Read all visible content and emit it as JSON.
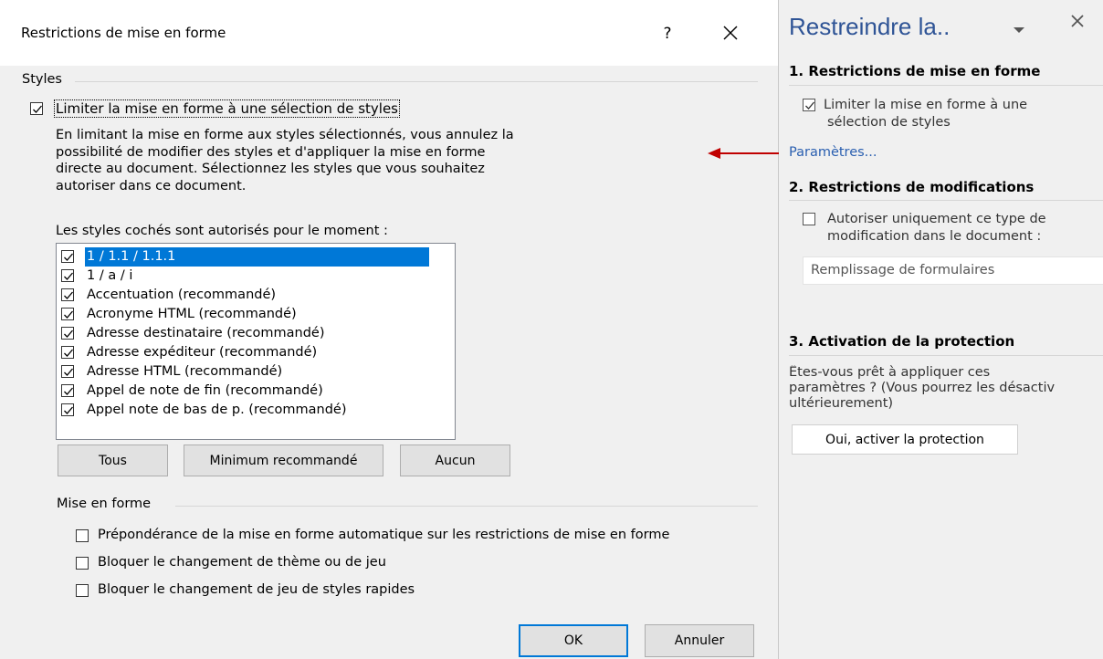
{
  "dialog": {
    "title": "Restrictions de mise en forme",
    "help_label": "?",
    "styles_group": "Styles",
    "limit_checkbox_label": "Limiter la mise en forme à une sélection de styles",
    "limit_checked": true,
    "description_lines": [
      "En limitant la mise en forme aux styles sélectionnés, vous annulez la",
      "possibilité de modifier des styles et d'appliquer la mise en forme",
      "directe au document. Sélectionnez les styles que vous souhaitez",
      "autoriser dans ce document."
    ],
    "list_label": "Les styles cochés sont autorisés pour le moment :",
    "styles": [
      {
        "label": "1 / 1.1 / 1.1.1",
        "checked": true,
        "selected": true
      },
      {
        "label": "1 / a / i",
        "checked": true,
        "selected": false
      },
      {
        "label": "Accentuation (recommandé)",
        "checked": true,
        "selected": false
      },
      {
        "label": "Acronyme HTML (recommandé)",
        "checked": true,
        "selected": false
      },
      {
        "label": "Adresse destinataire (recommandé)",
        "checked": true,
        "selected": false
      },
      {
        "label": "Adresse expéditeur (recommandé)",
        "checked": true,
        "selected": false
      },
      {
        "label": "Adresse HTML (recommandé)",
        "checked": true,
        "selected": false
      },
      {
        "label": "Appel de note de fin (recommandé)",
        "checked": true,
        "selected": false
      },
      {
        "label": "Appel note de bas de p. (recommandé)",
        "checked": true,
        "selected": false
      }
    ],
    "btn_all": "Tous",
    "btn_min": "Minimum recommandé",
    "btn_none": "Aucun",
    "format_group": "Mise en forme",
    "format_options": [
      "Prépondérance de la mise en forme automatique sur les restrictions de mise en forme",
      "Bloquer le changement de thème ou de jeu",
      "Bloquer le changement de jeu de styles rapides"
    ],
    "ok_label": "OK",
    "cancel_label": "Annuler"
  },
  "pane": {
    "title": "Restreindre la..",
    "section1_title": "1. Restrictions de mise en forme",
    "section1_checkbox_line1": "Limiter la mise en forme à une",
    "section1_checkbox_line2": "sélection de styles",
    "section1_checked": true,
    "settings_link": "Paramètres...",
    "section2_title": "2. Restrictions de modifications",
    "section2_checkbox_line1": "Autoriser uniquement ce type de",
    "section2_checkbox_line2": "modification dans le document :",
    "section2_checked": false,
    "edit_type_value": "Remplissage de formulaires",
    "section3_title": "3. Activation de la protection",
    "section3_text_line1": "Êtes-vous prêt à appliquer ces",
    "section3_text_line2": "paramètres ? (Vous pourrez les désactiv",
    "section3_text_line3": "ultérieurement)",
    "protect_button": "Oui, activer la protection"
  },
  "colors": {
    "selection": "#0078d7",
    "arrow": "#c00000",
    "link": "#2a5fb0"
  }
}
